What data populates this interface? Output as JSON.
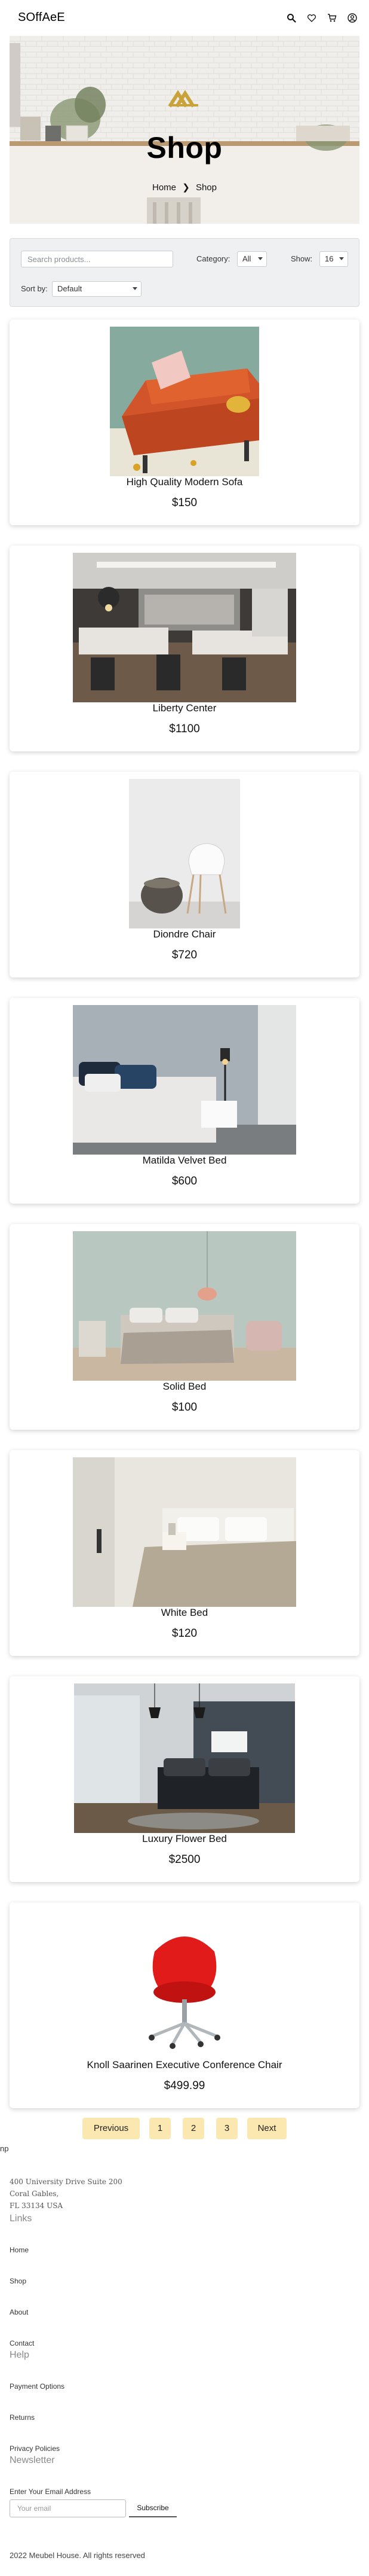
{
  "header": {
    "logo": "SOffAeE",
    "icons": [
      "search-icon",
      "heart-icon",
      "cart-icon",
      "user-icon"
    ]
  },
  "hero": {
    "title": "Shop",
    "breadcrumb": {
      "home": "Home",
      "separator": "❯",
      "current": "Shop"
    }
  },
  "filters": {
    "search_placeholder": "Search products...",
    "category_label": "Category:",
    "category_value": "All",
    "show_label": "Show:",
    "show_value": "16",
    "sort_label": "Sort by:",
    "sort_value": "Default"
  },
  "products": [
    {
      "name": "High Quality Modern Sofa",
      "price": "$150"
    },
    {
      "name": "Liberty Center",
      "price": "$1100"
    },
    {
      "name": "Diondre Chair",
      "price": "$720"
    },
    {
      "name": "Matilda Velvet Bed",
      "price": "$600"
    },
    {
      "name": "Solid Bed",
      "price": "$100"
    },
    {
      "name": "White Bed",
      "price": "$120"
    },
    {
      "name": "Luxury Flower Bed",
      "price": "$2500"
    },
    {
      "name": "Knoll Saarinen Executive Conference Chair",
      "price": "$499.99"
    }
  ],
  "pagination": {
    "prev": "Previous",
    "pages": [
      "1",
      "2",
      "3"
    ],
    "next": "Next"
  },
  "footer": {
    "brand_fragment": "np",
    "address": [
      "400 University Drive Suite 200",
      "Coral Gables,",
      "FL 33134 USA"
    ],
    "links_heading": "Links",
    "links": [
      "Home",
      "Shop",
      "About",
      "Contact"
    ],
    "help_heading": "Help",
    "help_links": [
      "Payment Options",
      "Returns",
      "Privacy Policies"
    ],
    "newsletter_heading": "Newsletter",
    "newsletter_label": "Enter Your Email Address",
    "email_placeholder": "Your email",
    "subscribe": "Subscribe",
    "copyright": "2022 Meubel House. All rights reserved"
  },
  "colors": {
    "accent": "#fbe7b0",
    "filter_bg": "#eef0f2",
    "logo_gold": "#c9a33a"
  }
}
